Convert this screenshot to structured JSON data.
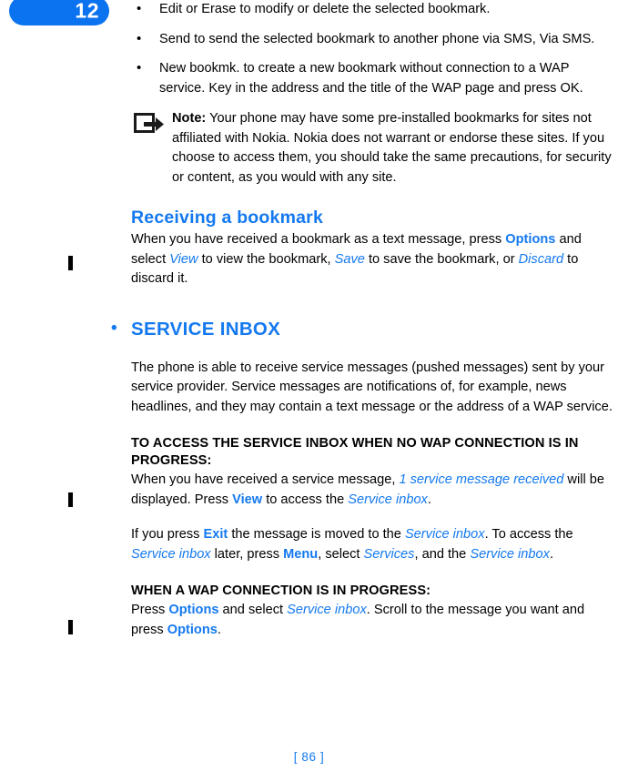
{
  "chapter": {
    "number": "12"
  },
  "bullets": [
    "Edit or Erase to modify or delete the selected bookmark.",
    "Send to send the selected bookmark to another phone via SMS, Via SMS.",
    "New bookmk. to create a new bookmark without connection to a WAP service. Key in the address and the title of the WAP page and press OK."
  ],
  "note": {
    "icon": "note-arrow-icon",
    "lead": "Note:",
    "text": " Your phone may have some pre-installed bookmarks for sites not affiliated with Nokia. Nokia does not warrant or endorse these sites. If you choose to access them, you should take the same precautions, for security or content, as you would with any site."
  },
  "receiving": {
    "title": "Receiving a bookmark",
    "p1_a": "When you have received a bookmark as a text message, press ",
    "p1_kw1": "Options",
    "p1_b": " and select ",
    "p1_ui1": "View",
    "p1_c": " to view the bookmark, ",
    "p1_ui2": "Save",
    "p1_d": " to save the bookmark, or ",
    "p1_ui3": "Discard",
    "p1_e": " to discard it."
  },
  "service_inbox": {
    "bullet_glyph": "•",
    "title": "SERVICE INBOX",
    "intro": "The phone is able to receive service messages (pushed messages) sent by your service provider. Service messages are notifications of, for example, news headlines, and they may contain a text message or the address of a WAP service.",
    "sub1_title": "TO ACCESS THE SERVICE INBOX WHEN NO WAP CONNECTION IS IN PROGRESS:",
    "sub1_p1_a": "When you have received a service message, ",
    "sub1_p1_ui1": "1 service message received",
    "sub1_p1_b": " will be displayed. Press ",
    "sub1_p1_kw1": "View",
    "sub1_p1_c": " to access the ",
    "sub1_p1_ui2": "Service inbox",
    "sub1_p1_d": ".",
    "sub1_p2_a": "If you press ",
    "sub1_p2_kw1": "Exit",
    "sub1_p2_b": " the message is moved to the ",
    "sub1_p2_ui1": "Service inbox",
    "sub1_p2_c": ". To access the ",
    "sub1_p2_ui2": "Service inbox",
    "sub1_p2_d": " later, press ",
    "sub1_p2_kw2": "Menu",
    "sub1_p2_e": ", select ",
    "sub1_p2_ui3": "Services",
    "sub1_p2_f": ", and the ",
    "sub1_p2_ui4": "Service inbox",
    "sub1_p2_g": ".",
    "sub2_title": "WHEN A WAP CONNECTION IS IN PROGRESS:",
    "sub2_p1_a": "Press ",
    "sub2_p1_kw1": "Options",
    "sub2_p1_b": " and select ",
    "sub2_p1_ui1": "Service inbox",
    "sub2_p1_c": ". Scroll to the message you want and press ",
    "sub2_p1_kw2": "Options",
    "sub2_p1_d": "."
  },
  "footer": {
    "page_label": "[ 86 ]"
  },
  "colors": {
    "accent_blue": "#1479ef",
    "badge_blue": "#0b72f0"
  }
}
